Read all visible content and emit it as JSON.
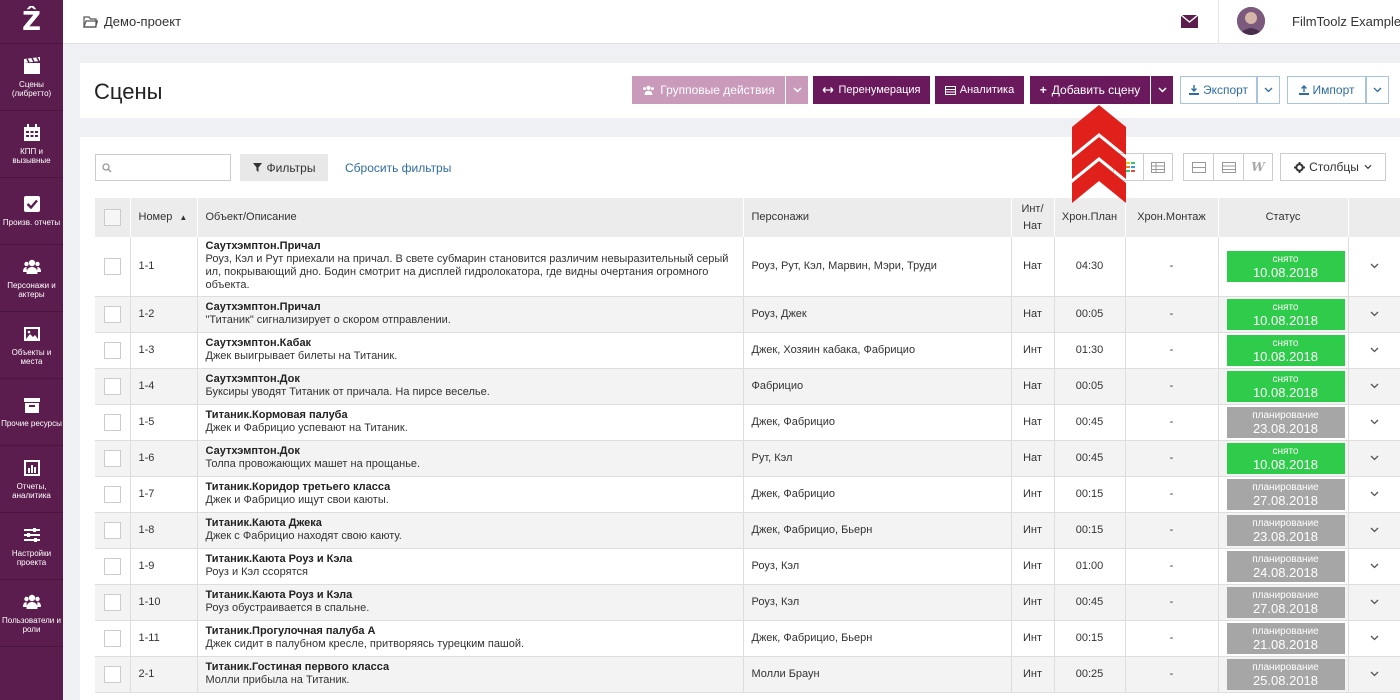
{
  "sidebar": {
    "logo": "Ẑ",
    "items": [
      {
        "label": "Сцены (либретто)",
        "icon": "clapperboard-icon"
      },
      {
        "label": "КПП и вызывные",
        "icon": "calendar-icon"
      },
      {
        "label": "Произв. отчеты",
        "icon": "checkbox-icon"
      },
      {
        "label": "Персонажи и актеры",
        "icon": "users-icon"
      },
      {
        "label": "Объекты и места",
        "icon": "image-icon"
      },
      {
        "label": "Прочие ресурсы",
        "icon": "box-icon"
      },
      {
        "label": "Отчеты, аналитика",
        "icon": "bar-chart-icon"
      },
      {
        "label": "Настройки проекта",
        "icon": "sliders-icon"
      },
      {
        "label": "Пользователи и роли",
        "icon": "users-icon"
      }
    ]
  },
  "topbar": {
    "project": "Демо-проект",
    "username": "FilmToolz Example"
  },
  "header": {
    "title": "Сцены",
    "group_actions": "Групповые действия",
    "renumber": "Перенумерация",
    "analytics": "Аналитика",
    "add_scene": "Добавить сцену",
    "export": "Экспорт",
    "import": "Импорт"
  },
  "toolbar": {
    "search_placeholder": "",
    "filters": "Фильтры",
    "reset_filters": "Сбросить фильтры",
    "columns": "Столбцы"
  },
  "table": {
    "headers": {
      "number": "Номер",
      "object": "Объект/Описание",
      "characters": "Персонажи",
      "int_nat": "Инт/ Нат",
      "chron_plan": "Хрон.План",
      "chron_montage": "Хрон.Монтаж",
      "status": "Статус"
    },
    "rows": [
      {
        "num": "1-1",
        "title": "Саутхэмптон.Причал",
        "desc": "Роуз, Кэл и Рут приехали на причал. В свете субмарин становится различим невыразительный серый ил, покрывающий дно. Бодин смотрит на дисплей гидролокатора, где видны очертания огромного объекта.",
        "chars": "Роуз, Рут, Кэл, Марвин, Мэри, Труди",
        "io": "Нат",
        "plan": "04:30",
        "montage": "-",
        "status_label": "снято",
        "status_date": "10.08.2018"
      },
      {
        "num": "1-2",
        "title": "Саутхэмптон.Причал",
        "desc": "\"Титаник\" сигнализирует о скором отправлении.",
        "chars": "Роуз, Джек",
        "io": "Нат",
        "plan": "00:05",
        "montage": "-",
        "status_label": "снято",
        "status_date": "10.08.2018"
      },
      {
        "num": "1-3",
        "title": "Саутхэмптон.Кабак",
        "desc": "Джек выигрывает билеты на Титаник.",
        "chars": "Джек, Хозяин кабака, Фабрицио",
        "io": "Инт",
        "plan": "01:30",
        "montage": "-",
        "status_label": "снято",
        "status_date": "10.08.2018"
      },
      {
        "num": "1-4",
        "title": "Саутхэмптон.Док",
        "desc": "Буксиры уводят Титаник от причала. На пирсе веселье.",
        "chars": "Фабрицио",
        "io": "Нат",
        "plan": "00:05",
        "montage": "-",
        "status_label": "снято",
        "status_date": "10.08.2018"
      },
      {
        "num": "1-5",
        "title": "Титаник.Кормовая палуба",
        "desc": "Джек и Фабрицио успевают на Титаник.",
        "chars": "Джек, Фабрицио",
        "io": "Нат",
        "plan": "00:45",
        "montage": "-",
        "status_label": "планирование",
        "status_date": "23.08.2018"
      },
      {
        "num": "1-6",
        "title": "Саутхэмптон.Док",
        "desc": "Толпа провожающих машет на прощанье.",
        "chars": "Рут, Кэл",
        "io": "Нат",
        "plan": "00:45",
        "montage": "-",
        "status_label": "снято",
        "status_date": "10.08.2018"
      },
      {
        "num": "1-7",
        "title": "Титаник.Коридор третьего класса",
        "desc": "Джек и Фабрицио ищут свои каюты.",
        "chars": "Джек, Фабрицио",
        "io": "Инт",
        "plan": "00:15",
        "montage": "-",
        "status_label": "планирование",
        "status_date": "27.08.2018"
      },
      {
        "num": "1-8",
        "title": "Титаник.Каюта Джека",
        "desc": "Джек с Фабрицио находят свою каюту.",
        "chars": "Джек, Фабрицио, Бьерн",
        "io": "Инт",
        "plan": "00:15",
        "montage": "-",
        "status_label": "планирование",
        "status_date": "23.08.2018"
      },
      {
        "num": "1-9",
        "title": "Титаник.Каюта Роуз и Кэла",
        "desc": "Роуз и Кэл ссорятся",
        "chars": "Роуз, Кэл",
        "io": "Инт",
        "plan": "01:00",
        "montage": "-",
        "status_label": "планирование",
        "status_date": "24.08.2018"
      },
      {
        "num": "1-10",
        "title": "Титаник.Каюта Роуз и Кэла",
        "desc": "Роуз обустраивается в спальне.",
        "chars": "Роуз, Кэл",
        "io": "Инт",
        "plan": "00:45",
        "montage": "-",
        "status_label": "планирование",
        "status_date": "27.08.2018"
      },
      {
        "num": "1-11",
        "title": "Титаник.Прогулочная палуба А",
        "desc": "Джек сидит в палубном кресле, притворяясь турецким пашой.",
        "chars": "Джек, Фабрицио, Бьерн",
        "io": "Инт",
        "plan": "00:15",
        "montage": "-",
        "status_label": "планирование",
        "status_date": "21.08.2018"
      },
      {
        "num": "2-1",
        "title": "Титаник.Гостиная первого класса",
        "desc": "Молли прибыла на Титаник.",
        "chars": "Молли Браун",
        "io": "Инт",
        "plan": "00:25",
        "montage": "-",
        "status_label": "планирование",
        "status_date": "25.08.2018"
      }
    ]
  },
  "colors": {
    "sidebar": "#5a1d4d",
    "primary": "#6a1a5c",
    "done": "#2ecc4a",
    "plan": "#a6a6a6",
    "link": "#2f6ca3",
    "annotation": "#e0201b"
  }
}
